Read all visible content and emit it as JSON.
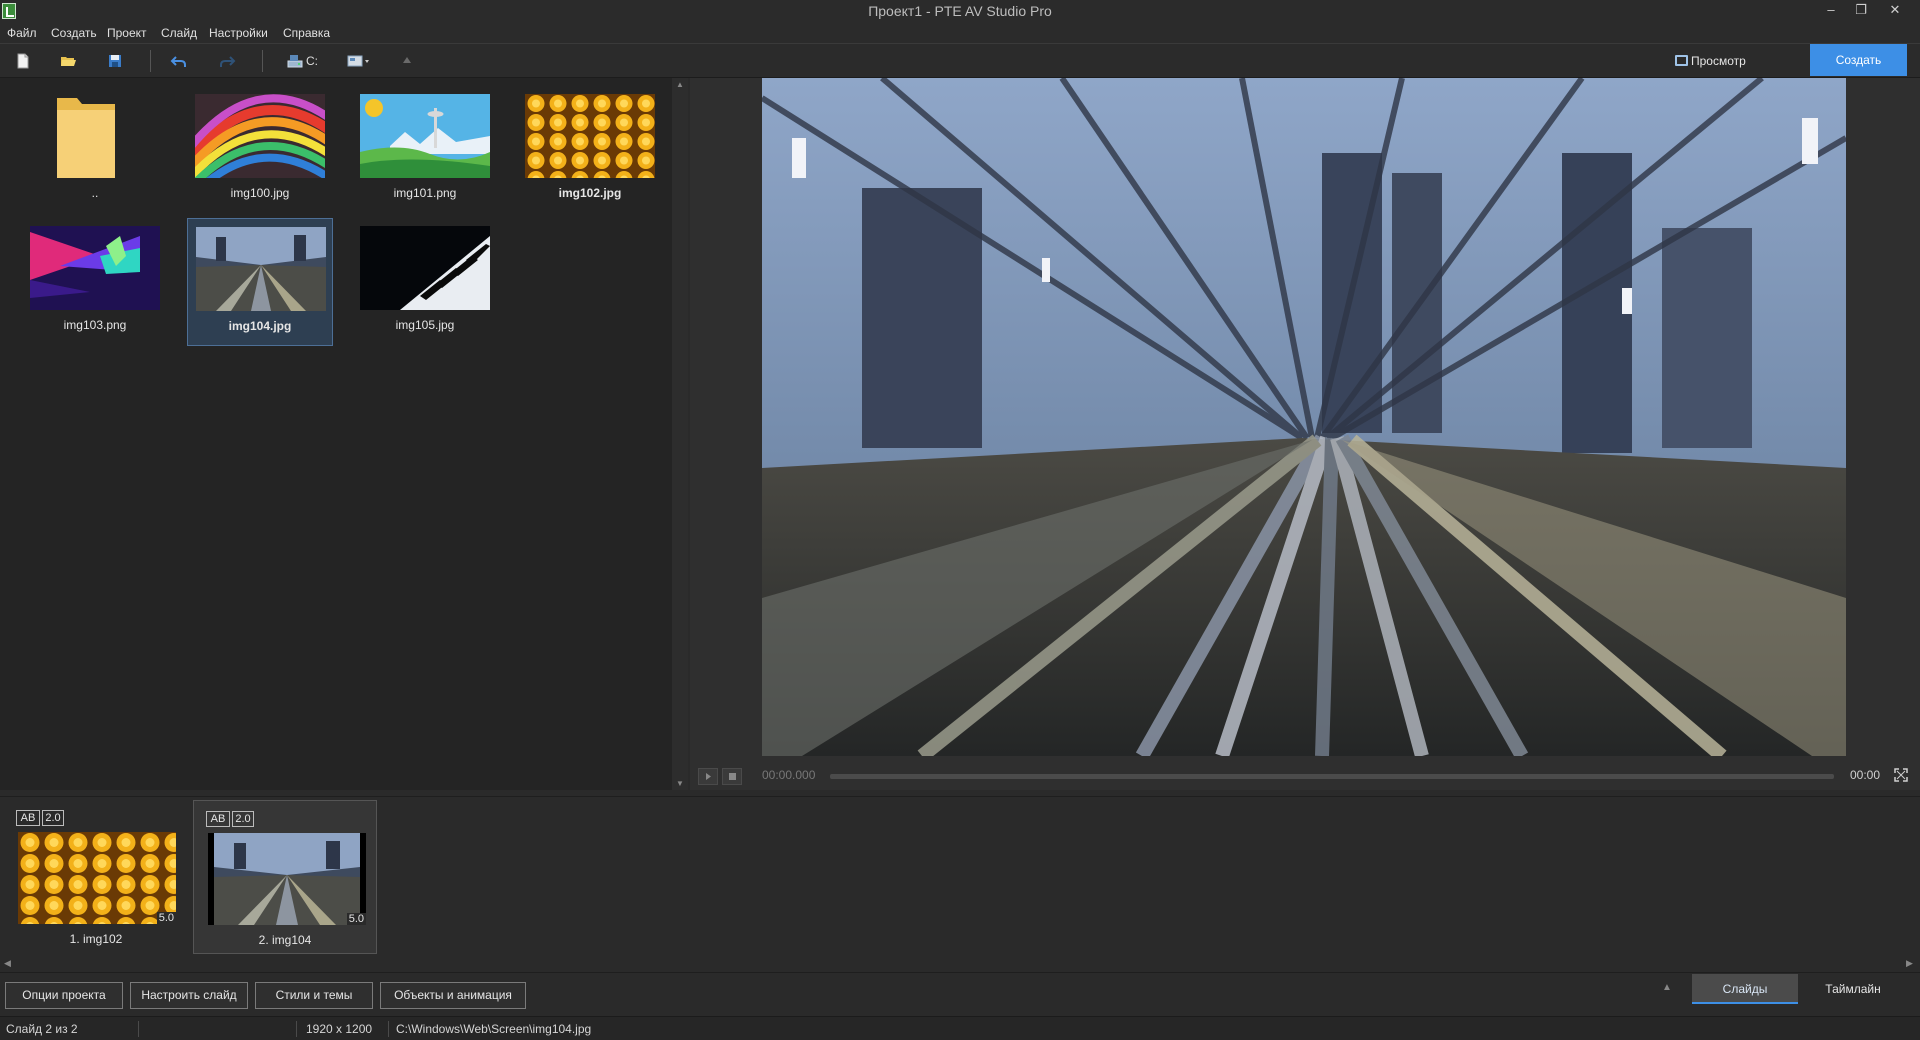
{
  "window": {
    "title": "Проект1 - PTE AV Studio Pro",
    "controls": {
      "minimize": "–",
      "restore": "❐",
      "close": "✕"
    }
  },
  "menu": [
    "Файл",
    "Создать",
    "Проект",
    "Слайд",
    "Настройки",
    "Справка"
  ],
  "toolbar": {
    "drive": "C:",
    "preview_label": "Просмотр",
    "create_label": "Создать",
    "icons": [
      "new-file-icon",
      "open-folder-icon",
      "save-icon",
      "undo-icon",
      "redo-icon",
      "drive-icon",
      "view-mode-icon",
      "up-arrow-icon"
    ]
  },
  "files": [
    {
      "label": "..",
      "kind": "folder"
    },
    {
      "label": "img100.jpg",
      "kind": "image",
      "bold": false
    },
    {
      "label": "img101.png",
      "kind": "image",
      "bold": false
    },
    {
      "label": "img102.jpg",
      "kind": "image",
      "bold": true
    },
    {
      "label": "img103.png",
      "kind": "image",
      "bold": false
    },
    {
      "label": "img104.jpg",
      "kind": "image",
      "bold": true,
      "selected": true
    },
    {
      "label": "img105.jpg",
      "kind": "image",
      "bold": false
    }
  ],
  "player": {
    "time_current": "00:00.000",
    "time_total": "00:00",
    "progress": 0
  },
  "slides": [
    {
      "label": "1. img102",
      "badge_ab": "AB",
      "badge_transition": "2.0",
      "duration": "5.0",
      "selected": false
    },
    {
      "label": "2. img104",
      "badge_ab": "AB",
      "badge_transition": "2.0",
      "duration": "5.0",
      "selected": true
    }
  ],
  "bottom_buttons": [
    "Опции проекта",
    "Настроить слайд",
    "Стили и темы",
    "Объекты и анимация"
  ],
  "view_tabs": {
    "slides": "Слайды",
    "timeline": "Таймлайн",
    "active": "slides"
  },
  "status": {
    "slide": "Слайд 2 из 2",
    "resolution": "1920 x 1200",
    "path": "C:\\Windows\\Web\\Screen\\img104.jpg"
  },
  "colors": {
    "accent": "#3d8fe6",
    "background": "#2a2a2a",
    "selection": "#2e3f52"
  }
}
